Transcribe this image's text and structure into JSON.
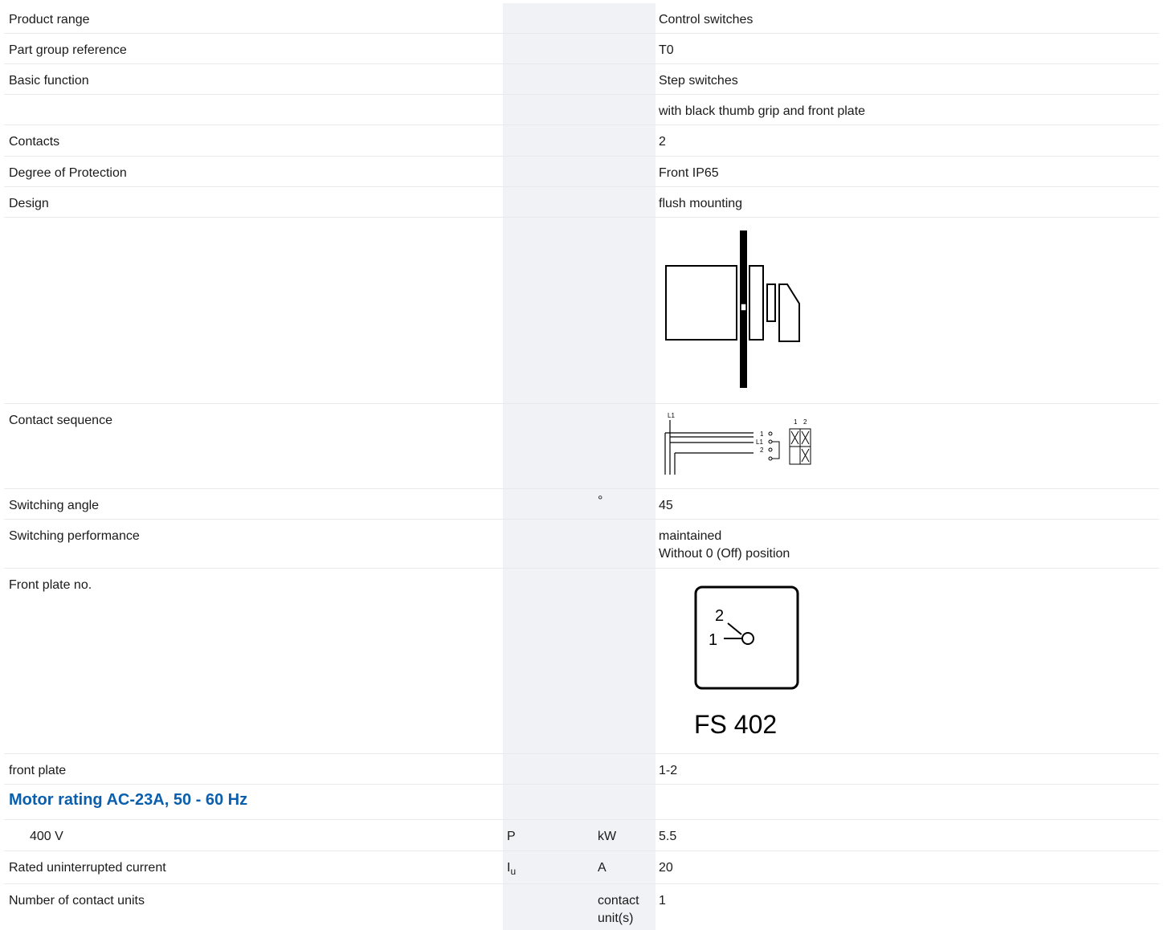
{
  "rows": {
    "product_range": {
      "label": "Product range",
      "value": "Control switches"
    },
    "part_group": {
      "label": "Part group reference",
      "value": "T0"
    },
    "basic_function": {
      "label": "Basic function",
      "value": "Step switches"
    },
    "basic_function_extra": {
      "value": "with black thumb grip and front plate"
    },
    "contacts": {
      "label": "Contacts",
      "value": "2"
    },
    "degree_protection": {
      "label": "Degree of Protection",
      "value": "Front IP65"
    },
    "design": {
      "label": "Design",
      "value": "flush mounting"
    },
    "contact_sequence": {
      "label": "Contact sequence",
      "diagram": {
        "line_label": "L1",
        "col_1": "1",
        "col_2": "2",
        "term_1": "1",
        "term_l1": "L1",
        "term_2": "2"
      }
    },
    "switching_angle": {
      "label": "Switching angle",
      "unit": "°",
      "value": "45"
    },
    "switching_performance": {
      "label": "Switching performance",
      "value_line1": "maintained",
      "value_line2": "Without 0 (Off) position"
    },
    "front_plate_no": {
      "label": "Front plate no.",
      "plate": {
        "pos_top": "2",
        "pos_left": "1",
        "caption": "FS 402"
      }
    },
    "front_plate": {
      "label": "front plate",
      "value": "1-2"
    },
    "motor_section": {
      "title": "Motor rating AC-23A, 50 - 60 Hz"
    },
    "motor_400v": {
      "label": "400 V",
      "symbol": "P",
      "unit": "kW",
      "value": "5.5"
    },
    "rated_current": {
      "label": "Rated uninterrupted current",
      "symbol_main": "I",
      "symbol_sub": "u",
      "unit": "A",
      "value": "20"
    },
    "contact_units": {
      "label": "Number of contact units",
      "unit_line1": "contact",
      "unit_line2": "unit(s)",
      "value": "1"
    }
  }
}
